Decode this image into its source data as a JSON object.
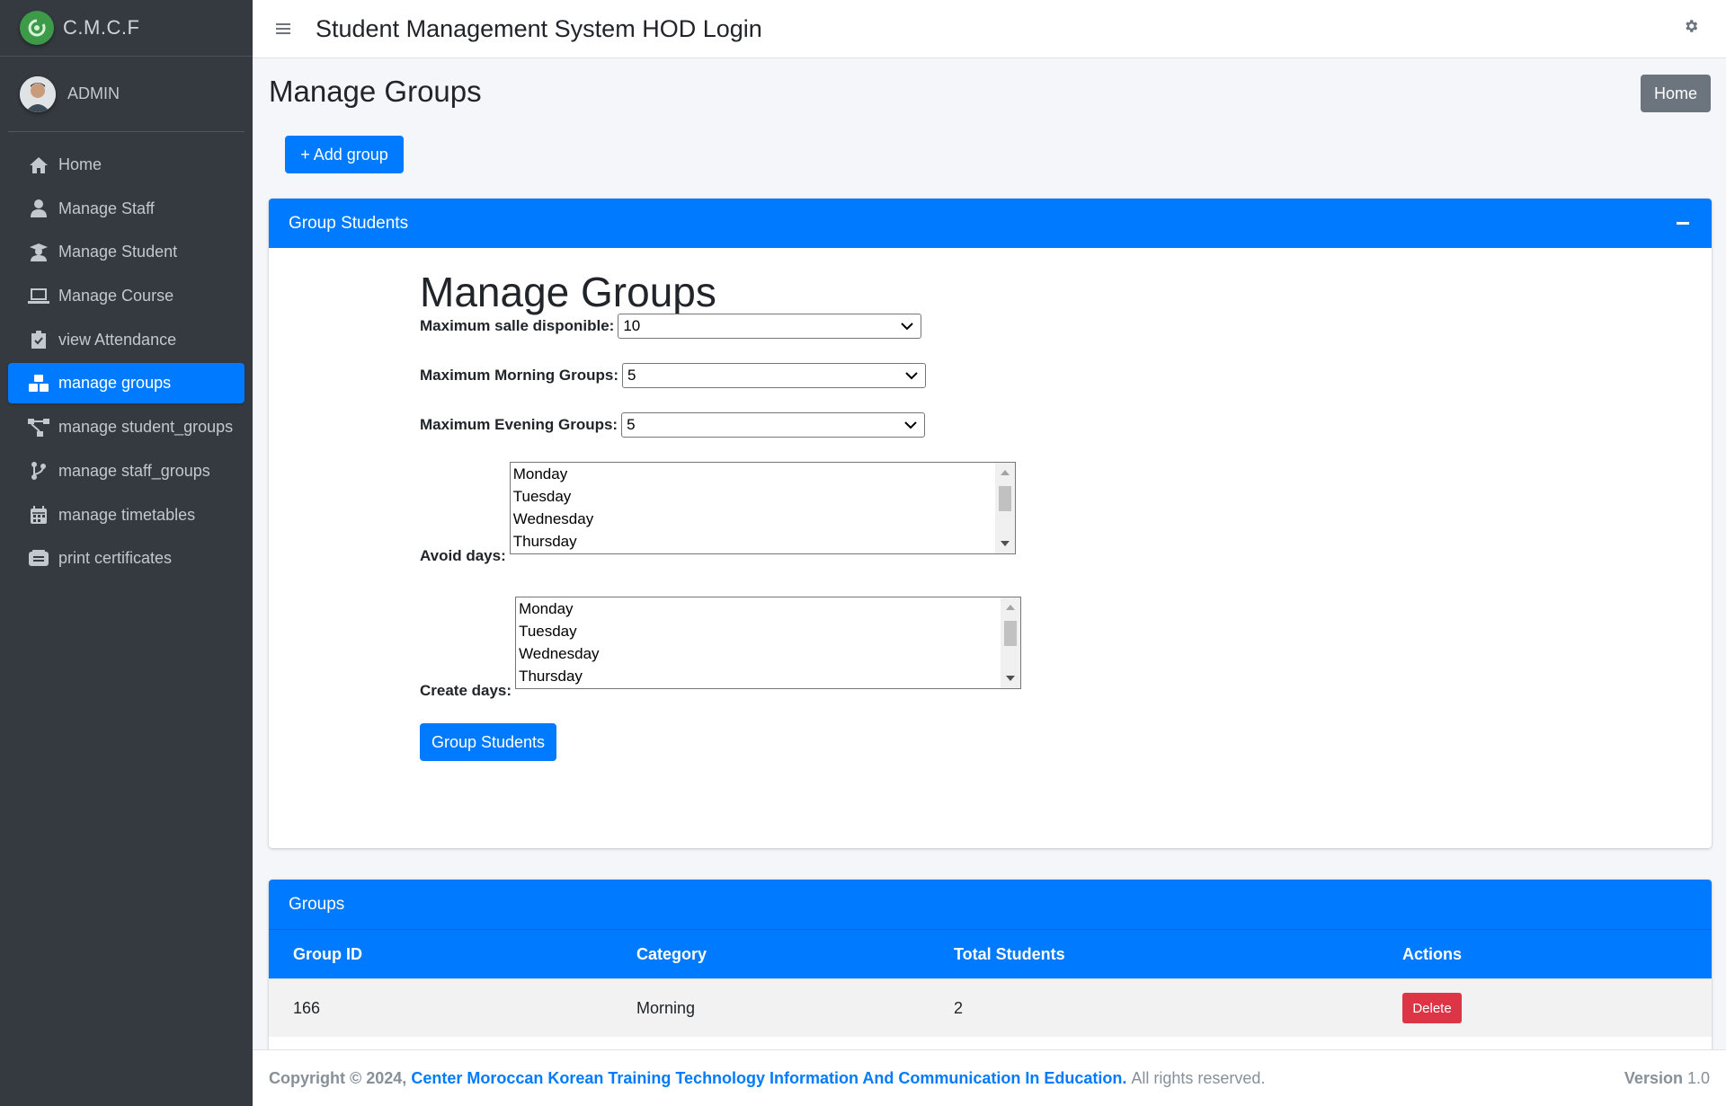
{
  "brand": {
    "name": "C.M.C.F",
    "logo_color": "#3c9a48"
  },
  "user": {
    "name": "ADMIN"
  },
  "sidebar": {
    "items": [
      {
        "label": "Home",
        "icon": "home-icon"
      },
      {
        "label": "Manage Staff",
        "icon": "user-icon"
      },
      {
        "label": "Manage Student",
        "icon": "graduate-icon"
      },
      {
        "label": "Manage Course",
        "icon": "laptop-icon"
      },
      {
        "label": "view Attendance",
        "icon": "clipboard-check-icon"
      },
      {
        "label": "manage groups",
        "icon": "cubes-icon",
        "active": true
      },
      {
        "label": "manage student_groups",
        "icon": "network-icon"
      },
      {
        "label": "manage staff_groups",
        "icon": "branch-icon"
      },
      {
        "label": "manage timetables",
        "icon": "calendar-icon"
      },
      {
        "label": "print certificates",
        "icon": "certificate-icon"
      }
    ]
  },
  "header": {
    "title": "Student Management System HOD Login"
  },
  "page": {
    "title": "Manage Groups",
    "home_button": "Home",
    "add_button": "+ Add group"
  },
  "group_card": {
    "header": "Group Students",
    "heading": "Manage Groups",
    "salle_label": "Maximum salle disponible:",
    "salle_value": "10",
    "morning_label": "Maximum Morning Groups:",
    "morning_value": "5",
    "evening_label": "Maximum Evening Groups:",
    "evening_value": "5",
    "avoid_label": "Avoid days:",
    "create_label": "Create days:",
    "days": [
      "Monday",
      "Tuesday",
      "Wednesday",
      "Thursday"
    ],
    "submit": "Group Students"
  },
  "groups_card": {
    "header": "Groups",
    "columns": [
      "Group ID",
      "Category",
      "Total Students",
      "Actions"
    ],
    "rows": [
      {
        "id": "166",
        "category": "Morning",
        "total": "2",
        "action": "Delete"
      }
    ]
  },
  "footer": {
    "copyright": "Copyright © 2024,",
    "org": "Center Moroccan Korean Training Technology Information And Communication In Education.",
    "rights": "All rights reserved.",
    "version_label": "Version",
    "version_value": "1.0"
  },
  "colors": {
    "primary": "#007bff",
    "sidebar": "#343a40",
    "danger": "#dc3545",
    "secondary": "#6c757d"
  }
}
